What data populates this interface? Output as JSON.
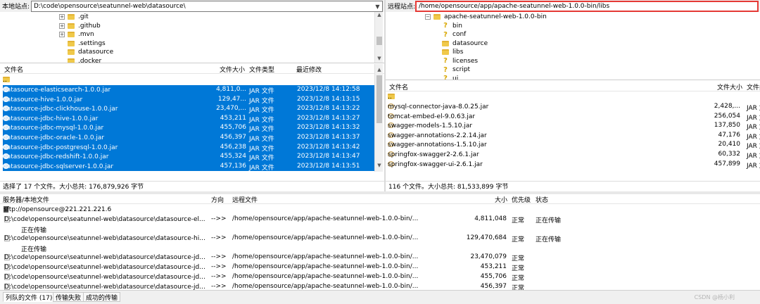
{
  "local": {
    "site_label": "本地站点:",
    "path": "D:\\code\\opensource\\seatunnel-web\\datasource\\",
    "tree": [
      ".git",
      ".github",
      ".mvn",
      ".settings",
      "datasource",
      ".docker"
    ],
    "columns": {
      "name": "文件名",
      "size": "文件大小",
      "type": "文件类型",
      "modified": "最近修改"
    },
    "parent": "..",
    "files": [
      {
        "name": "datasource-elasticsearch-1.0.0.jar",
        "size": "4,811,0...",
        "type": "JAR 文件",
        "modified": "2023/12/8 14:12:58"
      },
      {
        "name": "datasource-hive-1.0.0.jar",
        "size": "129,47...",
        "type": "JAR 文件",
        "modified": "2023/12/8 14:13:15"
      },
      {
        "name": "datasource-jdbc-clickhouse-1.0.0.jar",
        "size": "23,470,...",
        "type": "JAR 文件",
        "modified": "2023/12/8 14:13:22"
      },
      {
        "name": "datasource-jdbc-hive-1.0.0.jar",
        "size": "453,211",
        "type": "JAR 文件",
        "modified": "2023/12/8 14:13:27"
      },
      {
        "name": "datasource-jdbc-mysql-1.0.0.jar",
        "size": "455,706",
        "type": "JAR 文件",
        "modified": "2023/12/8 14:13:32"
      },
      {
        "name": "datasource-jdbc-oracle-1.0.0.jar",
        "size": "456,397",
        "type": "JAR 文件",
        "modified": "2023/12/8 14:13:37"
      },
      {
        "name": "datasource-jdbc-postgresql-1.0.0.jar",
        "size": "456,238",
        "type": "JAR 文件",
        "modified": "2023/12/8 14:13:42"
      },
      {
        "name": "datasource-jdbc-redshift-1.0.0.jar",
        "size": "455,324",
        "type": "JAR 文件",
        "modified": "2023/12/8 14:13:47"
      },
      {
        "name": "datasource-jdbc-sqlserver-1.0.0.jar",
        "size": "457,136",
        "type": "JAR 文件",
        "modified": "2023/12/8 14:13:51"
      }
    ],
    "status": "选择了 17 个文件。大小总共: 176,879,926 字节"
  },
  "remote": {
    "site_label": "远程站点:",
    "path": "/home/opensource/app/apache-seatunnel-web-1.0.0-bin/libs",
    "tree_root": "apache-seatunnel-web-1.0.0-bin",
    "tree": [
      "bin",
      "conf",
      "datasource",
      "libs",
      "licenses",
      "script",
      "ui"
    ],
    "columns": {
      "name": "文件名",
      "size": "文件大小",
      "type": "文件类"
    },
    "parent": "..",
    "files": [
      {
        "name": "mysql-connector-java-8.0.25.jar",
        "size": "2,428,...",
        "type": "JAR 文"
      },
      {
        "name": "tomcat-embed-el-9.0.63.jar",
        "size": "256,054",
        "type": "JAR 文"
      },
      {
        "name": "swagger-models-1.5.10.jar",
        "size": "137,850",
        "type": "JAR 文"
      },
      {
        "name": "swagger-annotations-2.2.14.jar",
        "size": "47,176",
        "type": "JAR 文"
      },
      {
        "name": "swagger-annotations-1.5.10.jar",
        "size": "20,410",
        "type": "JAR 文"
      },
      {
        "name": "springfox-swagger2-2.6.1.jar",
        "size": "60,332",
        "type": "JAR 文"
      },
      {
        "name": "springfox-swagger-ui-2.6.1.jar",
        "size": "457,899",
        "type": "JAR 文"
      }
    ],
    "status": "116 个文件。大小总共: 81,533,899 字节"
  },
  "queue": {
    "columns": {
      "server": "服务器/本地文件",
      "direction": "方向",
      "remote": "远程文件",
      "size": "大小",
      "priority": "优先级",
      "status": "状态"
    },
    "server": "sftp://opensource@221.221.221.6",
    "items": [
      {
        "local": "D:\\code\\opensource\\seatunnel-web\\datasource\\datasource-el...",
        "dir": "-->>",
        "remote": "/home/opensource/app/apache-seatunnel-web-1.0.0-bin/...",
        "size": "4,811,048",
        "priority": "正常",
        "status": "正在传输",
        "sub": "正在传输"
      },
      {
        "local": "D:\\code\\opensource\\seatunnel-web\\datasource\\datasource-hi...",
        "dir": "-->>",
        "remote": "/home/opensource/app/apache-seatunnel-web-1.0.0-bin/...",
        "size": "129,470,684",
        "priority": "正常",
        "status": "正在传输",
        "sub": "正在传输"
      },
      {
        "local": "D:\\code\\opensource\\seatunnel-web\\datasource\\datasource-jd...",
        "dir": "-->>",
        "remote": "/home/opensource/app/apache-seatunnel-web-1.0.0-bin/...",
        "size": "23,470,079",
        "priority": "正常",
        "status": ""
      },
      {
        "local": "D:\\code\\opensource\\seatunnel-web\\datasource\\datasource-jd...",
        "dir": "-->>",
        "remote": "/home/opensource/app/apache-seatunnel-web-1.0.0-bin/...",
        "size": "453,211",
        "priority": "正常",
        "status": ""
      },
      {
        "local": "D:\\code\\opensource\\seatunnel-web\\datasource\\datasource-jd...",
        "dir": "-->>",
        "remote": "/home/opensource/app/apache-seatunnel-web-1.0.0-bin/...",
        "size": "455,706",
        "priority": "正常",
        "status": ""
      },
      {
        "local": "D:\\code\\opensource\\seatunnel-web\\datasource\\datasource-jd...",
        "dir": "-->>",
        "remote": "/home/opensource/app/apache-seatunnel-web-1.0.0-bin/...",
        "size": "456,397",
        "priority": "正常",
        "status": ""
      }
    ]
  },
  "tabs": [
    "列队的文件 (17)",
    "传输失败",
    "成功的传输"
  ],
  "watermark": "CSDN @杨小利",
  "highlight_color": "#e53935",
  "selection_color": "#0078d7"
}
